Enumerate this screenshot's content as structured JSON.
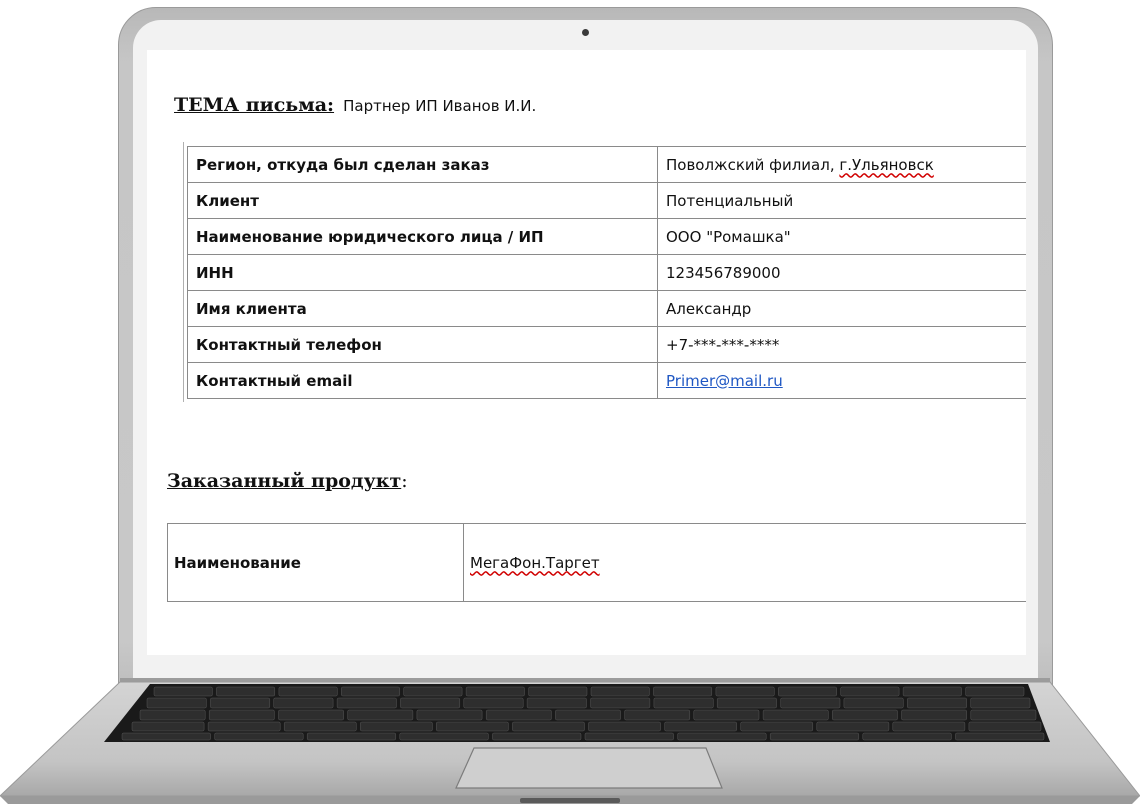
{
  "email": {
    "subject_label": "ТЕМА письма:",
    "subject_value": "Партнер ИП Иванов И.И.",
    "info_rows": [
      {
        "key": "Регион, откуда был сделан заказ",
        "value_plain": "Поволжский филиал, ",
        "value_marked": "г.Ульяновск"
      },
      {
        "key": "Клиент",
        "value": "Потенциальный"
      },
      {
        "key": "Наименование юридического лица / ИП",
        "value": "ООО \"Ромашка\""
      },
      {
        "key": "ИНН",
        "value": "123456789000"
      },
      {
        "key": "Имя клиента",
        "value": "Александр"
      },
      {
        "key": "Контактный телефон",
        "value": "+7-***-***-****"
      },
      {
        "key": "Контактный email",
        "value": "Primer@mail.ru"
      }
    ],
    "product_heading": "Заказанный продукт",
    "product_heading_colon": ":",
    "product_row": {
      "key": "Наименование",
      "value": "МегаФон.Таргет"
    }
  },
  "colors": {
    "link": "#1f57c3",
    "spellcheck": "#d00000",
    "laptop_body": "#c6c6c6",
    "keyboard": "#1c1c1c"
  }
}
